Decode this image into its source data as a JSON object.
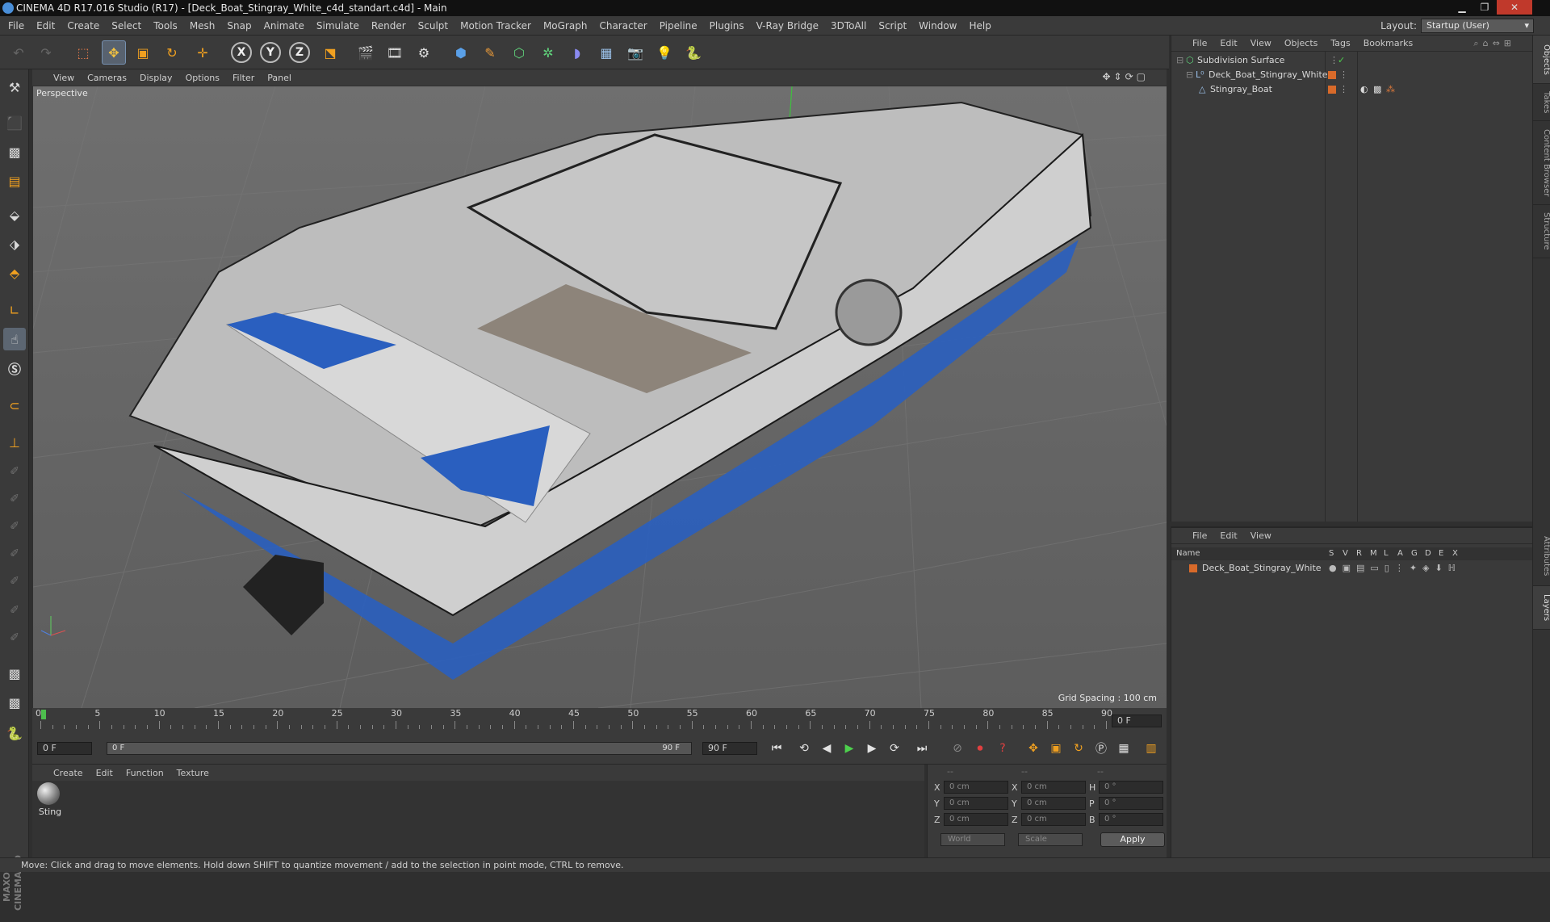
{
  "window": {
    "title": "CINEMA 4D R17.016 Studio (R17) - [Deck_Boat_Stingray_White_c4d_standart.c4d] - Main"
  },
  "menubar": [
    "File",
    "Edit",
    "Create",
    "Select",
    "Tools",
    "Mesh",
    "Snap",
    "Animate",
    "Simulate",
    "Render",
    "Sculpt",
    "Motion Tracker",
    "MoGraph",
    "Character",
    "Pipeline",
    "Plugins",
    "V-Ray Bridge",
    "3DToAll",
    "Script",
    "Window",
    "Help"
  ],
  "layout": {
    "label": "Layout:",
    "value": "Startup (User)"
  },
  "toolbar": {
    "axis_x": "X",
    "axis_y": "Y",
    "axis_z": "Z"
  },
  "viewport": {
    "menu": [
      "View",
      "Cameras",
      "Display",
      "Options",
      "Filter",
      "Panel"
    ],
    "label": "Perspective",
    "grid_spacing": "Grid Spacing : 100 cm"
  },
  "timeline": {
    "ticks": [
      "0",
      "5",
      "10",
      "15",
      "20",
      "25",
      "30",
      "35",
      "40",
      "45",
      "50",
      "55",
      "60",
      "65",
      "70",
      "75",
      "80",
      "85",
      "90"
    ],
    "current_frame": "0 F",
    "max": 90
  },
  "transport": {
    "start": "0 F",
    "range_start": "0 F",
    "range_end": "90 F",
    "end": "90 F"
  },
  "material_manager": {
    "menu": [
      "Create",
      "Edit",
      "Function",
      "Texture"
    ],
    "materials": [
      {
        "name": "Sting"
      }
    ]
  },
  "coordinates": {
    "header": [
      "--",
      "--",
      "--"
    ],
    "rows": [
      {
        "a": "X",
        "pos": "0 cm",
        "b": "X",
        "size": "0 cm",
        "c": "H",
        "rot": "0 °"
      },
      {
        "a": "Y",
        "pos": "0 cm",
        "b": "Y",
        "size": "0 cm",
        "c": "P",
        "rot": "0 °"
      },
      {
        "a": "Z",
        "pos": "0 cm",
        "b": "Z",
        "size": "0 cm",
        "c": "B",
        "rot": "0 °"
      }
    ],
    "mode": "World",
    "transform": "Scale",
    "apply": "Apply"
  },
  "object_manager": {
    "menu": [
      "File",
      "Edit",
      "View",
      "Objects",
      "Tags",
      "Bookmarks"
    ],
    "objects": [
      {
        "name": "Subdivision Surface"
      },
      {
        "name": "Deck_Boat_Stingray_White"
      },
      {
        "name": "Stingray_Boat"
      }
    ]
  },
  "layer_manager": {
    "menu": [
      "File",
      "Edit",
      "View"
    ],
    "columns": {
      "name": "Name",
      "flags": [
        "S",
        "V",
        "R",
        "M",
        "L",
        "A",
        "G",
        "D",
        "E",
        "X"
      ]
    },
    "layers": [
      {
        "name": "Deck_Boat_Stingray_White",
        "color": "#d86a2a"
      }
    ]
  },
  "side_tabs": [
    "Objects",
    "Takes",
    "Content Browser",
    "Structure",
    "Attributes",
    "Layers"
  ],
  "statusbar": "Move: Click and drag to move elements. Hold down SHIFT to quantize movement / add to the selection in point mode, CTRL to remove.",
  "brand": "MAXON CINEMA 4D",
  "colors": {
    "accent": "#4a8fd9",
    "layer_orange": "#d86a2a",
    "hull_blue": "#2a5fbf"
  }
}
